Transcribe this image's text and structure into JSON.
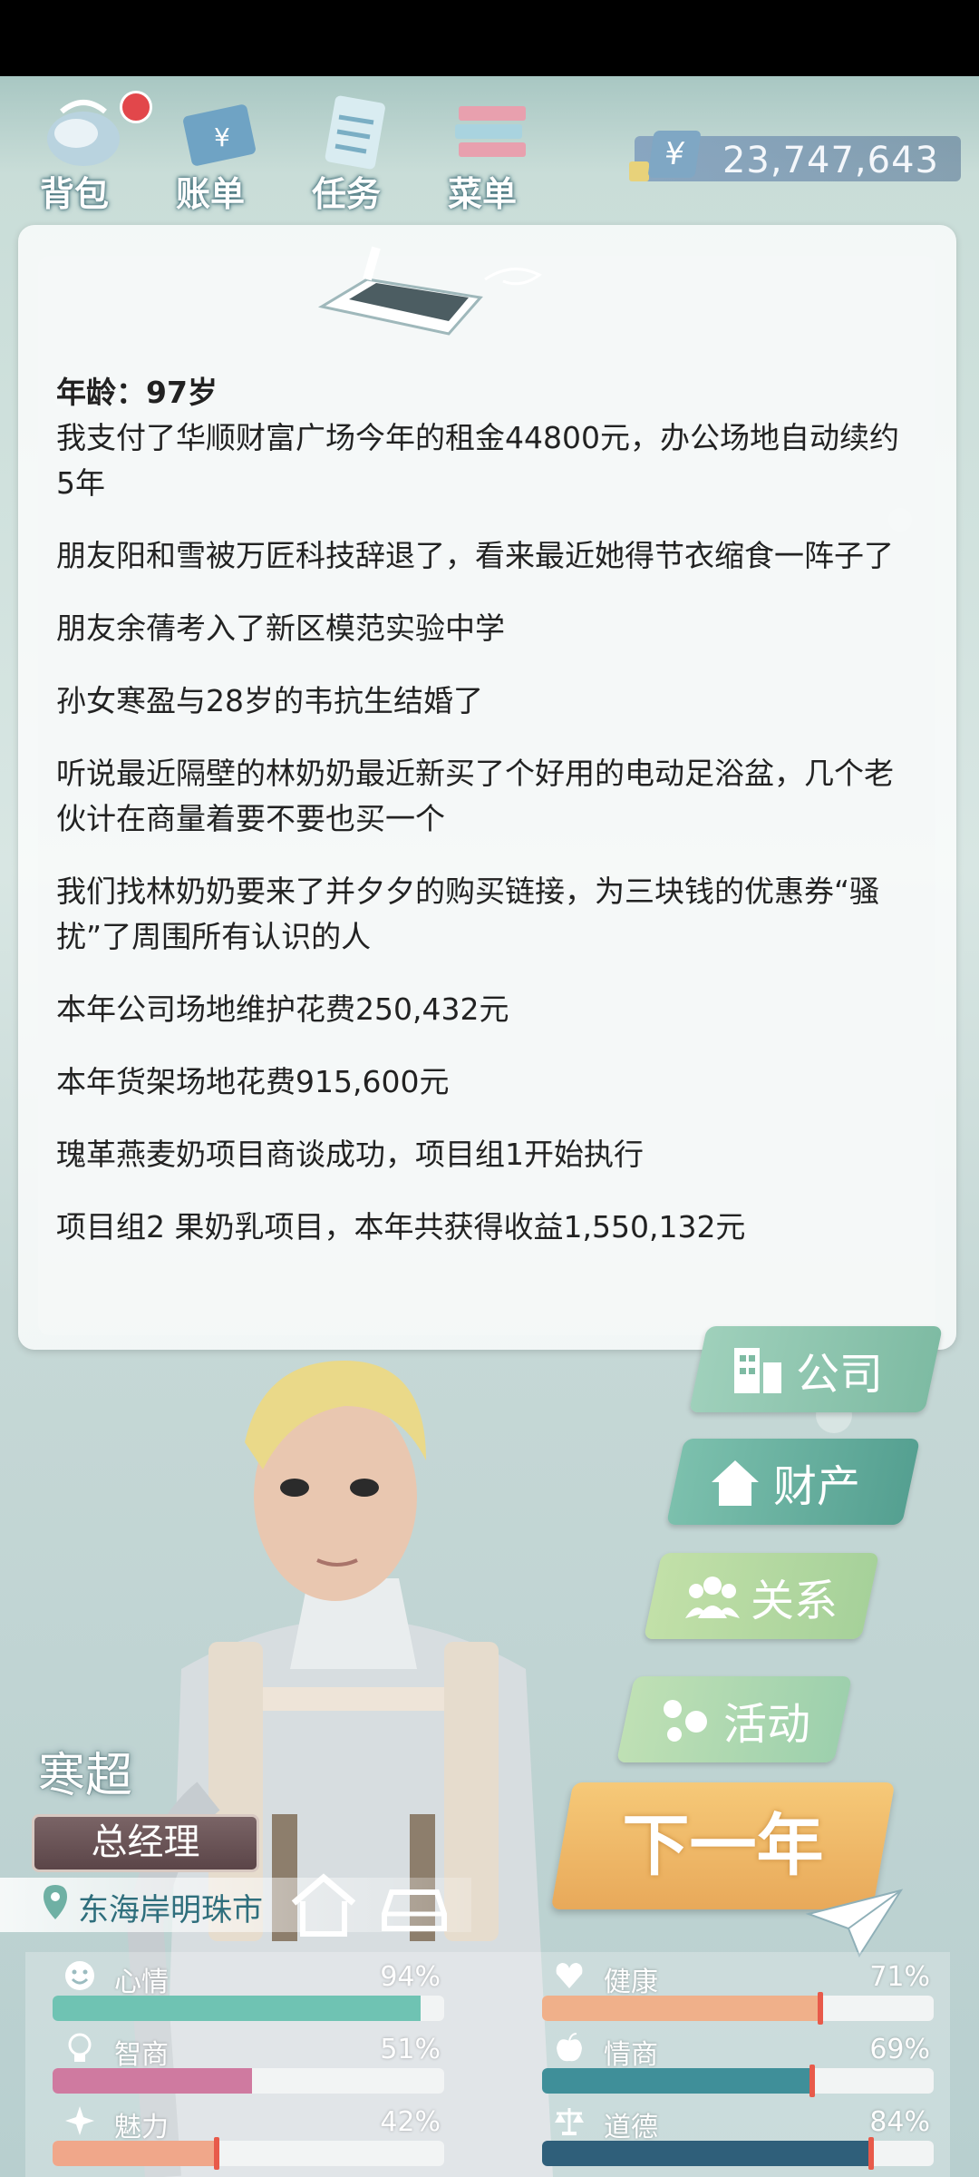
{
  "toolbar": {
    "items": [
      {
        "label": "背包"
      },
      {
        "label": "账单"
      },
      {
        "label": "任务"
      },
      {
        "label": "菜单"
      }
    ],
    "money": {
      "currency_symbol": "¥",
      "value": "23,747,643"
    }
  },
  "log": {
    "age": "年龄：97岁",
    "entries": [
      "我支付了华顺财富广场今年的租金44800元，办公场地自动续约5年",
      "朋友阳和雪被万匠科技辞退了，看来最近她得节衣缩食一阵子了",
      "朋友余蒨考入了新区模范实验中学",
      "孙女寒盈与28岁的韦抗生结婚了",
      "听说最近隔壁的林奶奶最近新买了个好用的电动足浴盆，几个老伙计在商量着要不要也买一个",
      "我们找林奶奶要来了并夕夕的购买链接，为三块钱的优惠券“骚扰”了周围所有认识的人",
      "本年公司场地维护花费250,432元",
      "本年货架场地花费915,600元",
      "瑰革燕麦奶项目商谈成功，项目组1开始执行",
      "项目组2 果奶乳项目，本年共获得收益1,550,132元"
    ]
  },
  "character": {
    "name": "寒超",
    "title": "总经理",
    "location": "东海岸明珠市"
  },
  "side_buttons": {
    "company": "公司",
    "assets": "财产",
    "relations": "关系",
    "activity": "活动",
    "next_year": "下一年"
  },
  "stats": [
    {
      "label": "心情",
      "pct_text": "94%",
      "value": 0.94,
      "color": "#6fc3b3"
    },
    {
      "label": "健康",
      "pct_text": "71%",
      "value": 0.71,
      "color": "#f0b08a"
    },
    {
      "label": "智商",
      "pct_text": "51%",
      "value": 0.51,
      "color": "#cf7aa0"
    },
    {
      "label": "情商",
      "pct_text": "69%",
      "value": 0.69,
      "color": "#3f8f99"
    },
    {
      "label": "魅力",
      "pct_text": "42%",
      "value": 0.42,
      "color": "#f0a78a"
    },
    {
      "label": "道德",
      "pct_text": "84%",
      "value": 0.84,
      "color": "#2f5f7a"
    }
  ]
}
